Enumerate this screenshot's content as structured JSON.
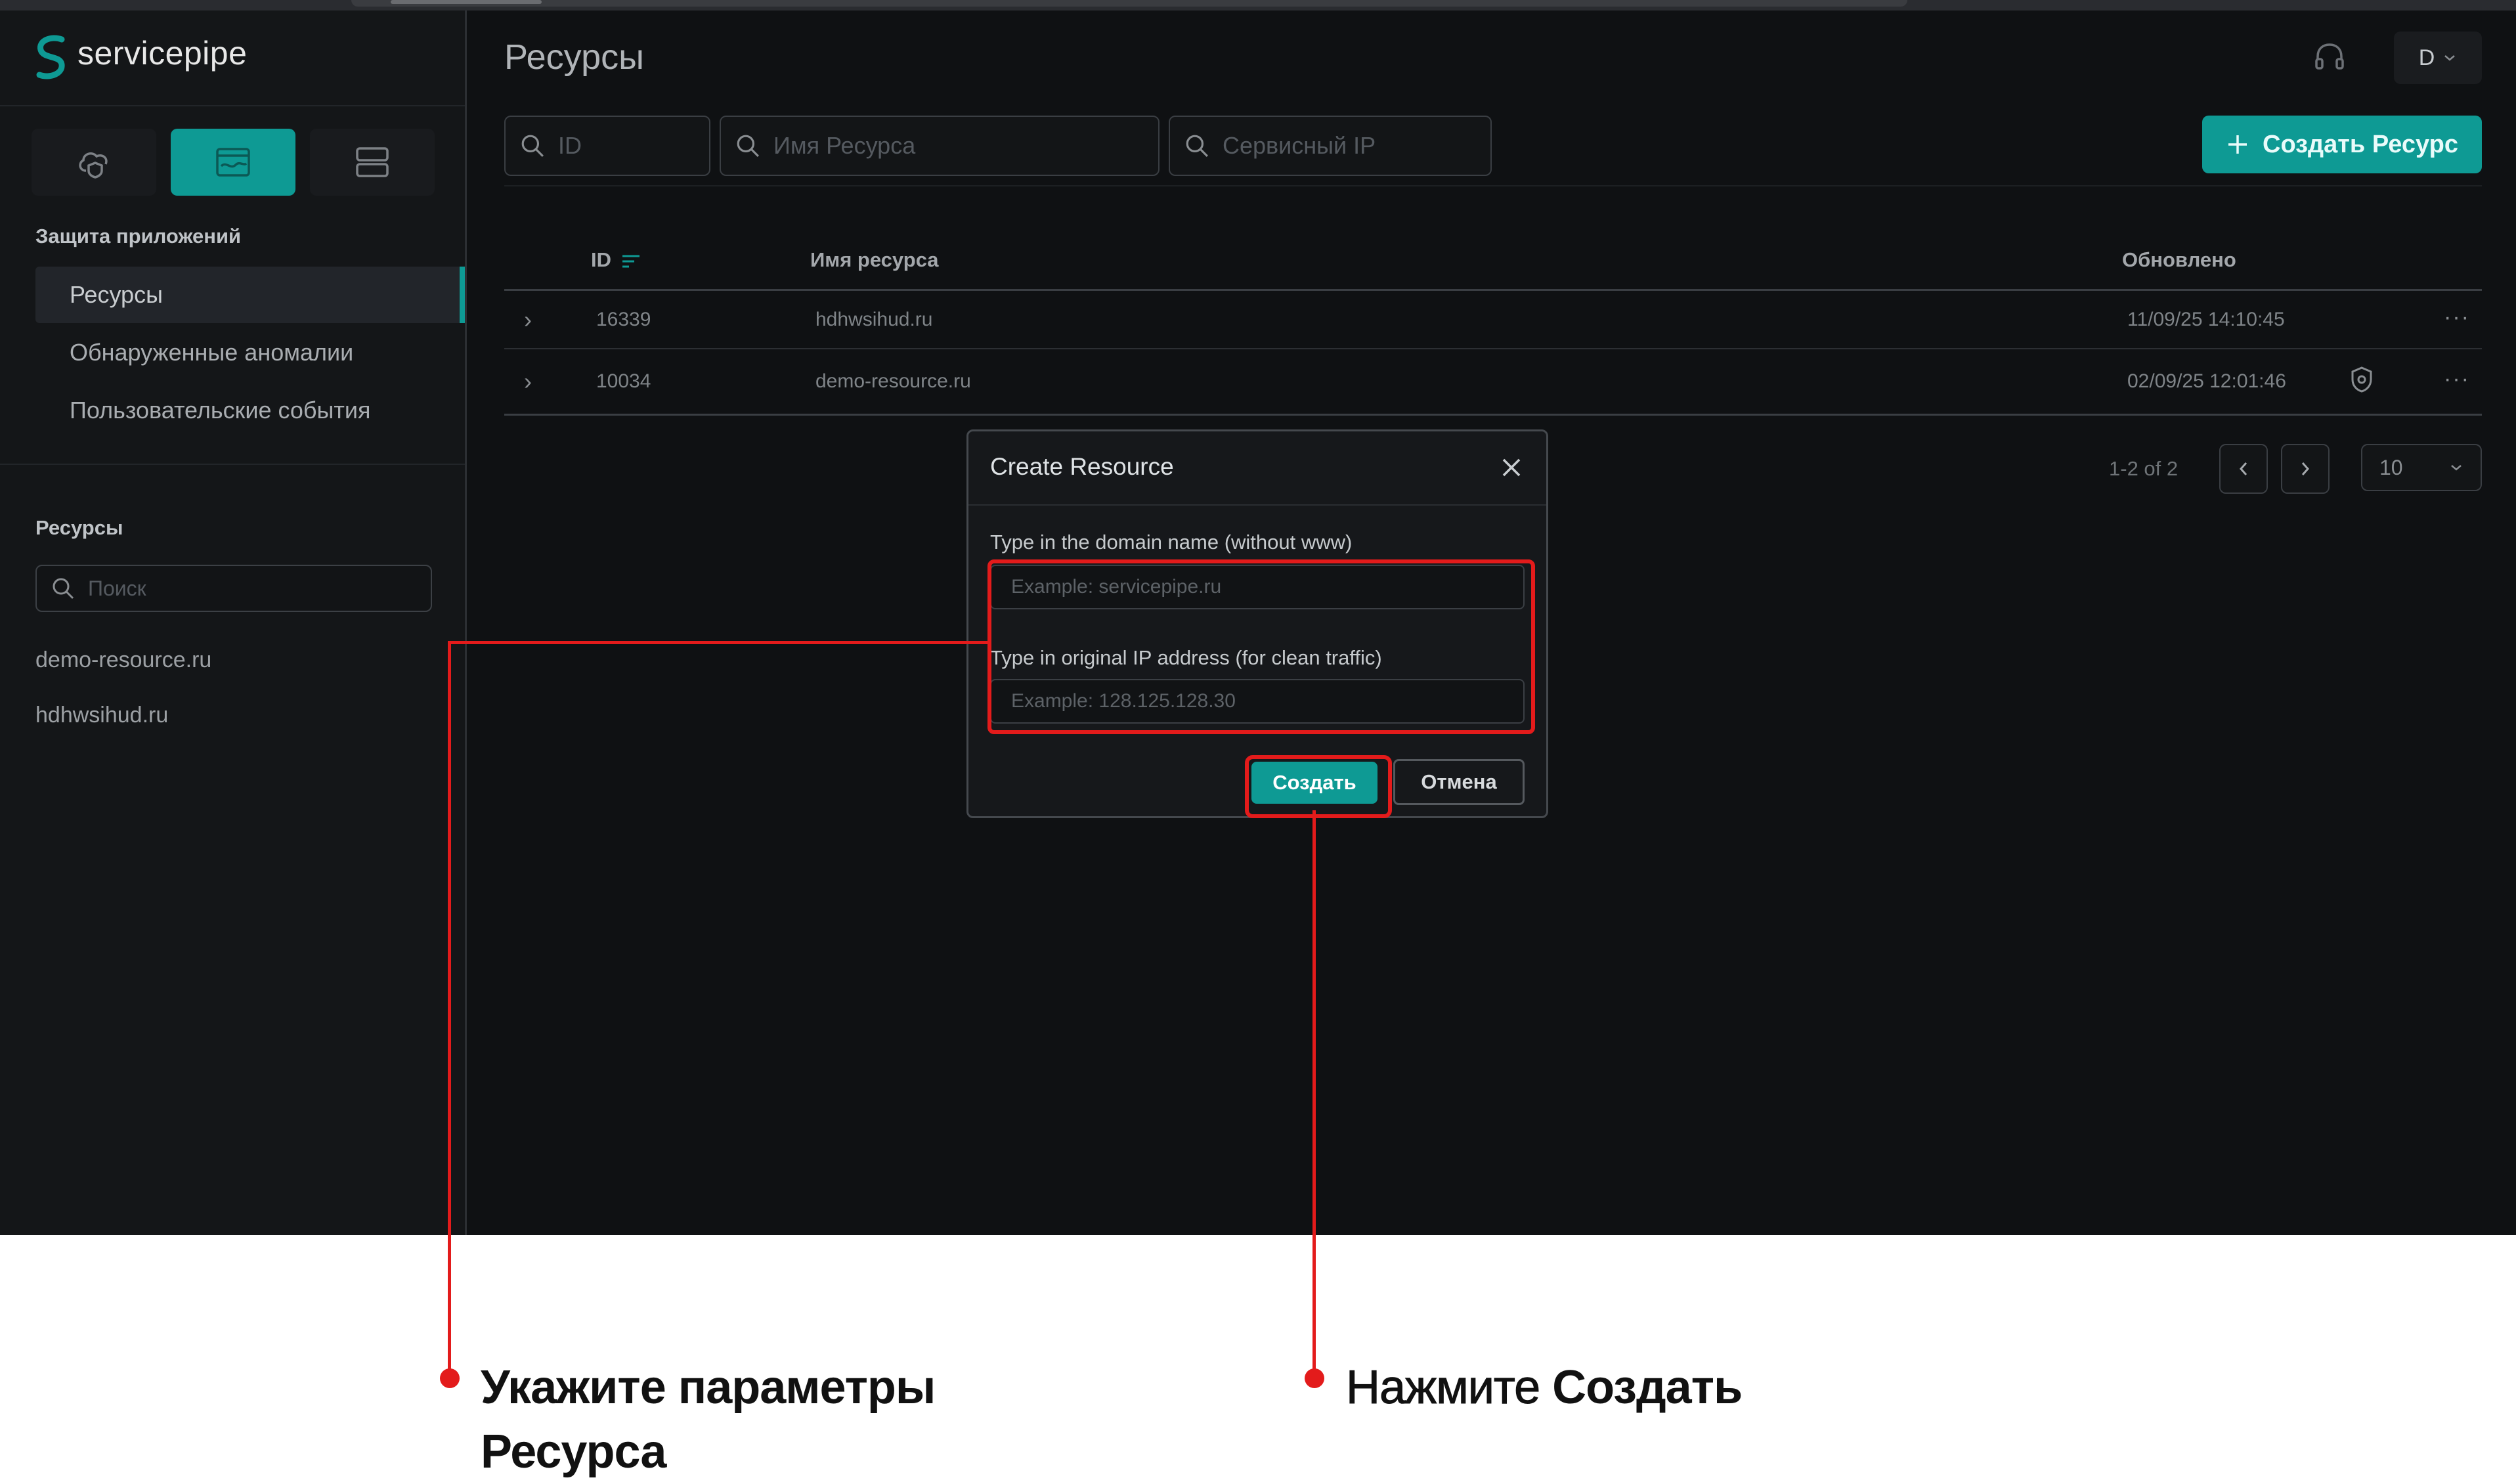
{
  "brand": {
    "name": "servicepipe"
  },
  "sidebar": {
    "section_title": "Защита приложений",
    "nav": [
      {
        "label": "Ресурсы"
      },
      {
        "label": "Обнаруженные аномалии"
      },
      {
        "label": "Пользовательские события"
      }
    ],
    "resources_title": "Ресурсы",
    "search_placeholder": "Поиск",
    "resources": [
      {
        "label": "demo-resource.ru"
      },
      {
        "label": "hdhwsihud.ru"
      }
    ]
  },
  "header": {
    "title": "Ресурсы",
    "user_initial": "D"
  },
  "filters": {
    "id_placeholder": "ID",
    "name_placeholder": "Имя Ресурса",
    "ip_placeholder": "Сервисный IP"
  },
  "toolbar": {
    "create_label": "Создать Ресурс"
  },
  "table": {
    "columns": {
      "id": "ID",
      "name": "Имя ресурса",
      "updated": "Обновлено"
    },
    "rows": [
      {
        "id": "16339",
        "name": "hdhwsihud.ru",
        "updated": "11/09/25 14:10:45"
      },
      {
        "id": "10034",
        "name": "demo-resource.ru",
        "updated": "02/09/25 12:01:46"
      }
    ],
    "more_symbol": "···"
  },
  "pagination": {
    "summary": "1-2 of 2",
    "page_size": "10"
  },
  "modal": {
    "title": "Create Resource",
    "domain_label": "Type in the domain name (without www)",
    "domain_placeholder": "Example: servicepipe.ru",
    "ip_label": "Type in original IP address (for clean traffic)",
    "ip_placeholder": "Example: 128.125.128.30",
    "create_label": "Создать",
    "cancel_label": "Отмена"
  },
  "callouts": {
    "params_line1": "Укажите параметры",
    "params_line2": "Ресурса",
    "click_prefix": "Нажмите ",
    "click_bold": "Создать"
  },
  "colors": {
    "accent": "#0e9a94",
    "highlight": "#e31b1b",
    "background": "#0f1113"
  }
}
